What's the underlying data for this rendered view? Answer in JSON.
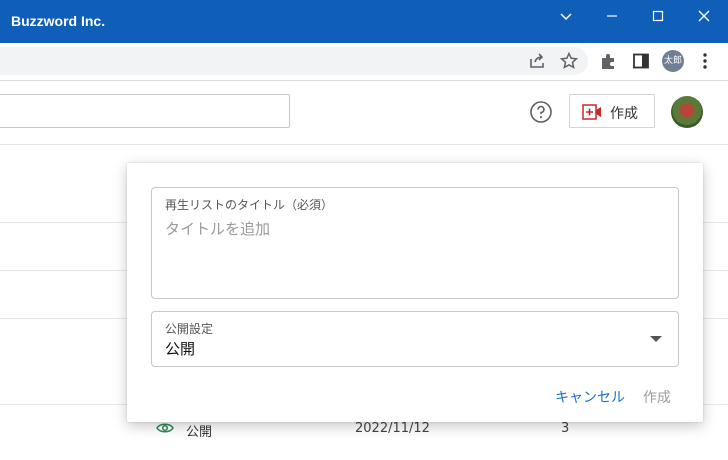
{
  "window": {
    "title": "Buzzword Inc.",
    "controls": [
      "chevron-down",
      "minimize",
      "maximize",
      "close"
    ]
  },
  "browser": {
    "profile_label": "太郎",
    "toolbar_icons": [
      "share-icon",
      "star-icon",
      "extensions-icon",
      "side-panel-icon",
      "more-vert-icon"
    ]
  },
  "header": {
    "search_value": "",
    "help_icon": "help-circle-icon",
    "create_label": "作成"
  },
  "dialog": {
    "title_field_label": "再生リストのタイトル（必須）",
    "title_placeholder": "タイトルを追加",
    "visibility_label": "公開設定",
    "visibility_value": "公開",
    "cancel_label": "キャンセル",
    "create_label": "作成"
  },
  "background_row": {
    "visibility": "公開",
    "date": "2022/11/12",
    "count": "3"
  },
  "colors": {
    "titlebar": "#0f5fb8",
    "accent_link": "#1a6fd0",
    "public_icon": "#2e8b57"
  }
}
